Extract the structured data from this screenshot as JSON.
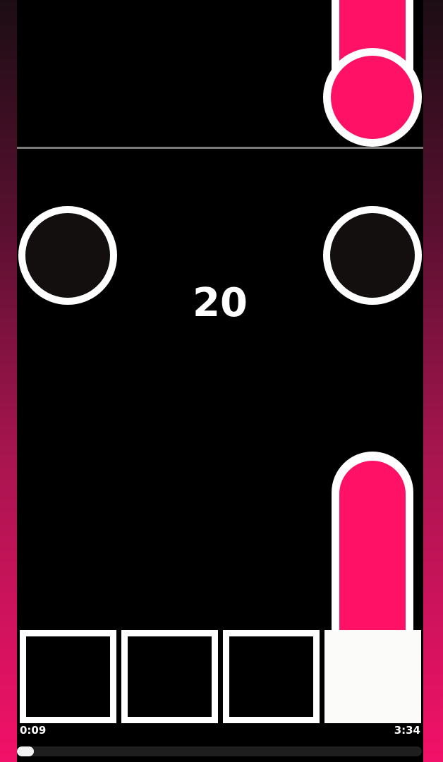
{
  "game": {
    "score": "20",
    "lanes": 4,
    "accent_color": "#ff1166",
    "tile_fill_color": "#fbfbf9"
  },
  "playback": {
    "elapsed": "0:09",
    "duration": "3:34",
    "progress": 0.042
  }
}
